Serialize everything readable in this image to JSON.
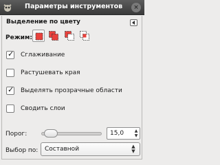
{
  "window": {
    "title": "Параметры инструментов",
    "close_glyph": "×"
  },
  "panel": {
    "tool_name": "Выделение по цвету"
  },
  "mode": {
    "label": "Режим:",
    "buttons": [
      "replace-mode-icon",
      "add-mode-icon",
      "subtract-mode-icon",
      "intersect-mode-icon"
    ],
    "active": "replace-mode-icon"
  },
  "options": [
    {
      "label": "Сглаживание",
      "checked": true
    },
    {
      "label": "Растушевать края",
      "checked": false
    },
    {
      "label": "Выделять прозрачные области",
      "checked": true
    },
    {
      "label": "Сводить слои",
      "checked": false
    }
  ],
  "threshold": {
    "label": "Порог:",
    "value": "15,0",
    "fraction": 0.06
  },
  "select_by": {
    "label": "Выбор по:",
    "value": "Составной"
  },
  "colors": {
    "accent": "#e8413c",
    "titlebar": "#4a4a4a"
  }
}
